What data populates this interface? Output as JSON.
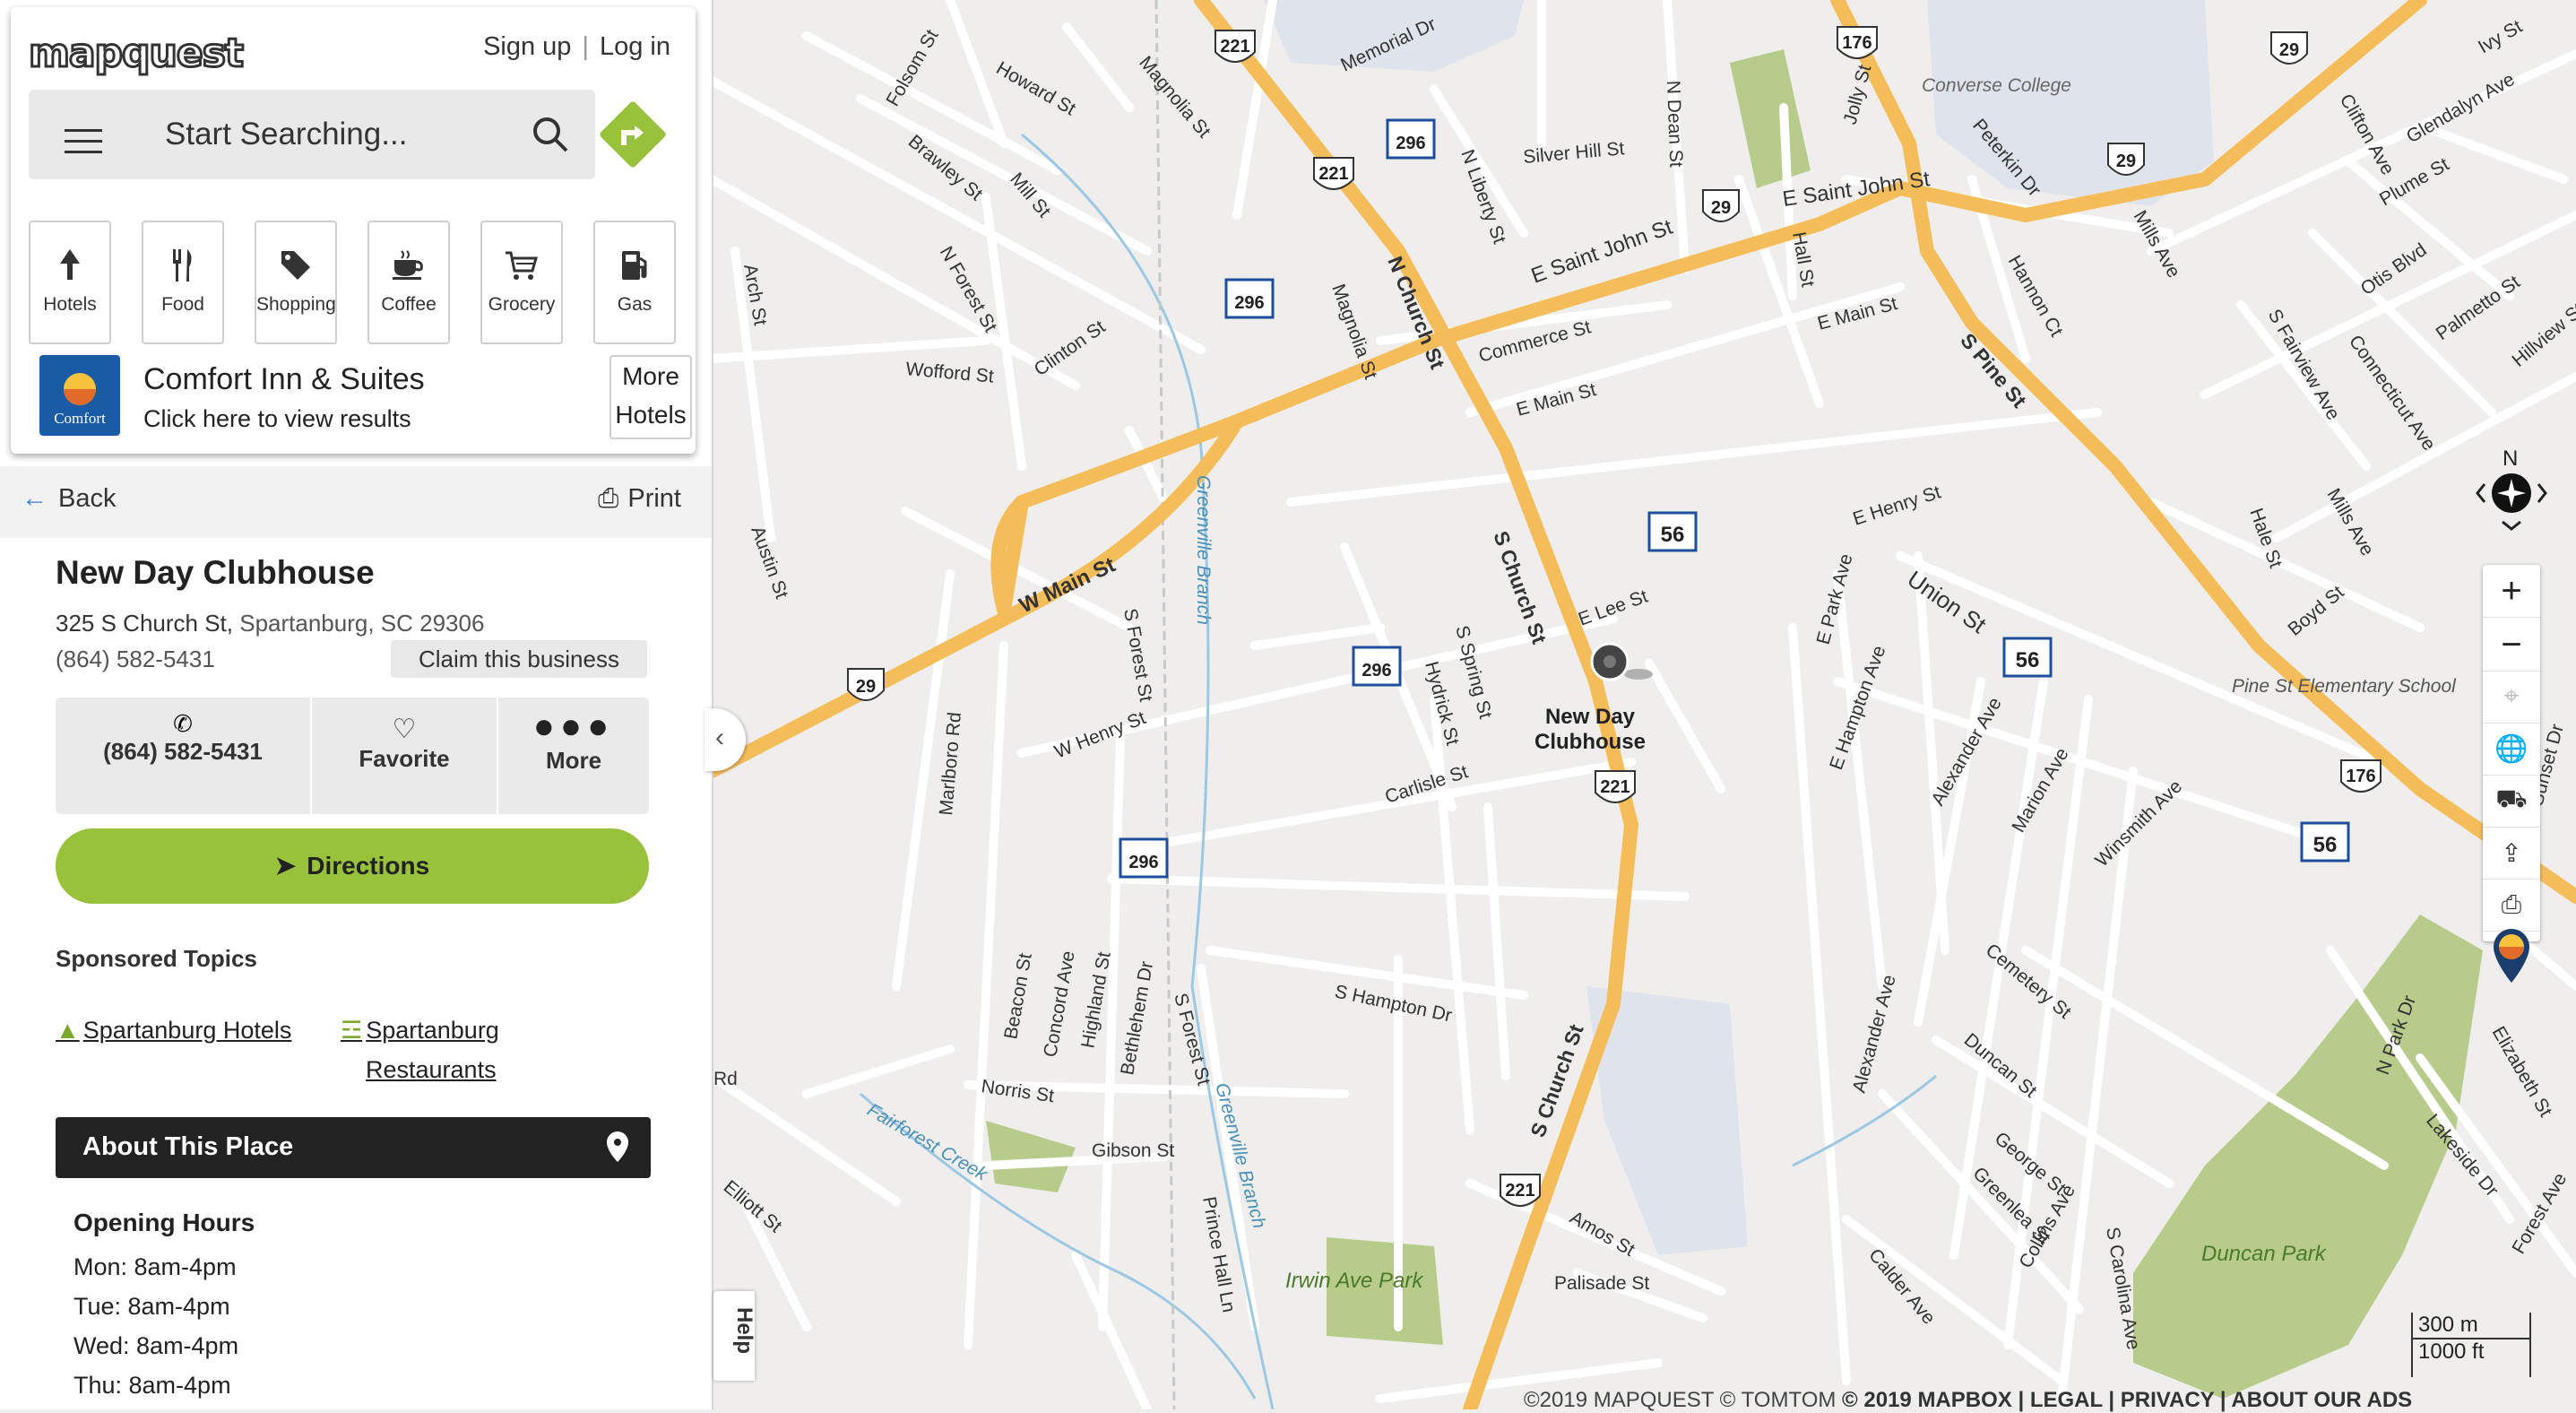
{
  "header": {
    "logo_text": "mapquest",
    "sign_up": "Sign up",
    "log_in": "Log in",
    "search_placeholder": "Start Searching..."
  },
  "categories": [
    {
      "label": "Hotels",
      "icon": "hotel-icon"
    },
    {
      "label": "Food",
      "icon": "food-icon"
    },
    {
      "label": "Shopping",
      "icon": "shopping-tag-icon"
    },
    {
      "label": "Coffee",
      "icon": "coffee-icon"
    },
    {
      "label": "Grocery",
      "icon": "cart-icon"
    },
    {
      "label": "Gas",
      "icon": "gas-icon"
    }
  ],
  "ad": {
    "title": "Comfort Inn & Suites",
    "subtitle": "Click here to view results",
    "more_line1": "More",
    "more_line2": "Hotels",
    "logo_text": "Comfort INN"
  },
  "nav": {
    "back": "Back",
    "print": "Print"
  },
  "place": {
    "name": "New Day Clubhouse",
    "street": "325 S Church St,",
    "city": "Spartanburg, SC 29306",
    "phone": "(864) 582-5431",
    "claim": "Claim this business"
  },
  "actions": {
    "phone": "(864) 582-5431",
    "favorite": "Favorite",
    "more": "More",
    "directions": "Directions"
  },
  "sponsored": {
    "title": "Sponsored Topics",
    "topic1": "Spartanburg Hotels",
    "topic2_line1": "Spartanburg",
    "topic2_line2": "Restaurants"
  },
  "about": {
    "title": "About This Place"
  },
  "hours": {
    "title": "Opening Hours",
    "days": [
      "Mon: 8am-4pm",
      "Tue: 8am-4pm",
      "Wed: 8am-4pm",
      "Thu: 8am-4pm"
    ]
  },
  "map": {
    "pin_label_line1": "New Day",
    "pin_label_line2": "Clubhouse",
    "compass_n": "N",
    "help": "Help",
    "scale_m": "300 m",
    "scale_ft": "1000 ft",
    "attribution_a": "©2019 MAPQUEST  © TOMTOM",
    "attribution_b": "© 2019 MAPBOX | LEGAL | PRIVACY | ABOUT OUR ADS",
    "street_labels": {
      "s1": "Memorial Dr",
      "s2": "Howard St",
      "s3": "Magnolia St",
      "s4": "Folsom St",
      "s5": "Brawley St",
      "s6": "Mill St",
      "s7": "N Forest St",
      "s8": "Arch St",
      "s9": "Wofford St",
      "s10": "Clinton St",
      "s11": "Magnolia St",
      "s12": "N Church St",
      "s13": "N Liberty St",
      "s14": "Silver Hill St",
      "s15": "N Dean St",
      "s16": "E Saint John St",
      "s17": "E Saint John St",
      "s18": "Commerce St",
      "s19": "E Main St",
      "s20": "E Main St",
      "s21": "Hall St",
      "s22": "Jolly St",
      "s23": "Converse College",
      "s24": "Peterkin Dr",
      "s25": "Hannon Ct",
      "s26": "S Pine St",
      "s27": "Mills Ave",
      "s28": "Clifton Ave",
      "s29": "Glendalyn Ave",
      "s30": "Plume St",
      "s31": "Ivy St",
      "s32": "Otis Blvd",
      "s33": "Palmetto St",
      "s34": "Hillview St",
      "s35": "S Fairview Ave",
      "s36": "Connecticut Ave",
      "s37": "Mills Ave",
      "s38": "Hale St",
      "s39": "Boyd St",
      "s40": "Pine St Elementary School",
      "s41": "Austin St",
      "s42": "W Main St",
      "s43": "Greenville Branch",
      "s44": "S Forest St",
      "s45": "S Church St",
      "s46": "E Lee St",
      "s47": "E Henry St",
      "s48": "Union St",
      "s49": "E Park Ave",
      "s50": "E Hampton Ave",
      "s51": "Alexander Ave",
      "s52": "Marion Ave",
      "s53": "Winsmith Ave",
      "s54": "Sunset Dr",
      "s55": "Marlboro Rd",
      "s56": "W Henry St",
      "s57": "Hydrick St",
      "s58": "S Spring St",
      "s59": "Carlisle St",
      "s60": "Beacon St",
      "s61": "Concord Ave",
      "s62": "Highland St",
      "s63": "Bethlehem Dr",
      "s64": "S Forest St",
      "s65": "S Hampton Dr",
      "s66": "S Church St",
      "s67": "Norris St",
      "s68": "Gibson St",
      "s69": "Fairforest Creek",
      "s70": "Greenville Branch",
      "s71": "Prince Hall Ln",
      "s72": "Irwin Ave Park",
      "s73": "Amos St",
      "s74": "Palisade St",
      "s75": "Alexander Ave",
      "s76": "Cemetery St",
      "s77": "Duncan St",
      "s78": "George St",
      "s79": "Greenlea St",
      "s80": "Collins Ave",
      "s81": "Calder Ave",
      "s82": "S Carolina Ave",
      "s83": "Duncan Park",
      "s84": "N Park Dr",
      "s85": "Lakeside Dr",
      "s86": "Elizabeth St",
      "s87": "Forest Ave",
      "s88": "Elliott St",
      "s89": "Rd",
      "s90": "Union St"
    },
    "shields": {
      "i221a": "221",
      "i221b": "221",
      "i221c": "221",
      "i221d": "221",
      "i176a": "176",
      "i176b": "176",
      "i29a": "29",
      "i29b": "29",
      "i29c": "29",
      "i29d": "29",
      "i296a": "296",
      "i296b": "296",
      "i296c": "296",
      "i296d": "296",
      "i56a": "56",
      "i56b": "56",
      "i56c": "56"
    }
  }
}
